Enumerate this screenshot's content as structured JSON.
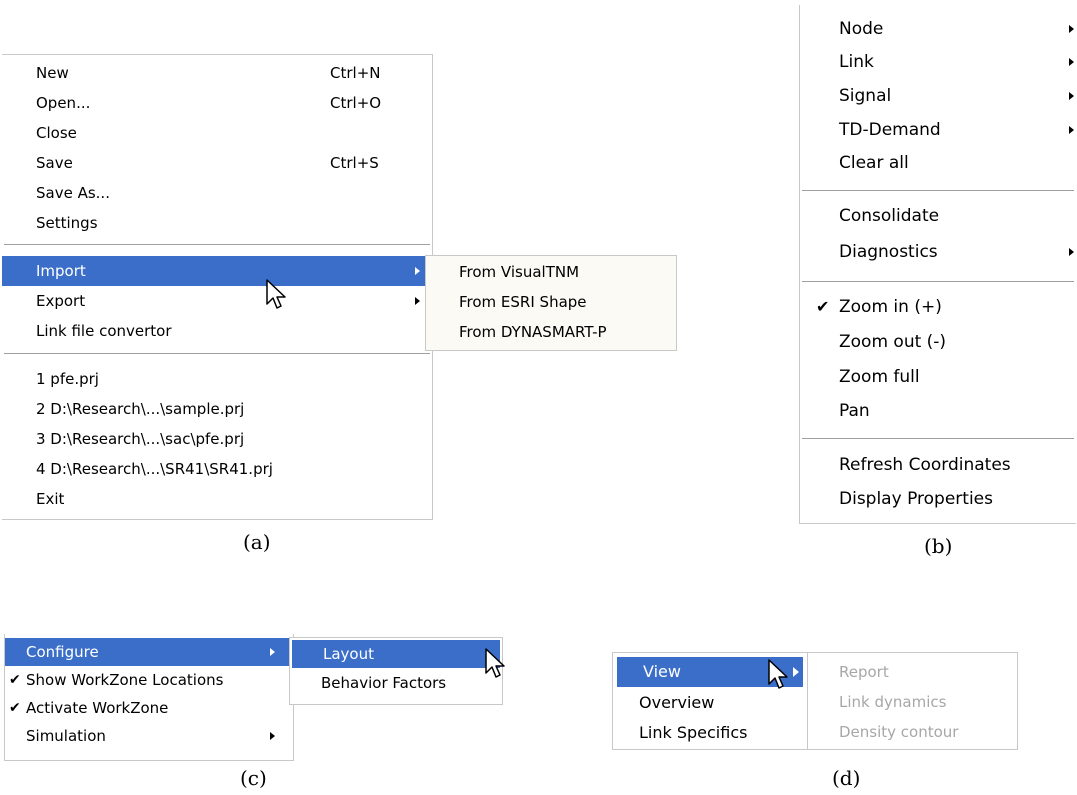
{
  "panel_a": {
    "caption": "(a)",
    "file_menu": {
      "new": {
        "label": "New",
        "shortcut": "Ctrl+N"
      },
      "open": {
        "label": "Open...",
        "shortcut": "Ctrl+O"
      },
      "close": {
        "label": "Close"
      },
      "save": {
        "label": "Save",
        "shortcut": "Ctrl+S"
      },
      "save_as": {
        "label": "Save As..."
      },
      "settings": {
        "label": "Settings"
      },
      "import": {
        "label": "Import"
      },
      "export": {
        "label": "Export"
      },
      "link_file_convertor": {
        "label": "Link file convertor"
      },
      "recent": [
        "1 pfe.prj",
        "2 D:\\Research\\...\\sample.prj",
        "3 D:\\Research\\...\\sac\\pfe.prj",
        "4 D:\\Research\\...\\SR41\\SR41.prj"
      ],
      "exit": {
        "label": "Exit"
      }
    },
    "import_submenu": [
      "From VisualTNM",
      "From ESRI Shape",
      "From DYNASMART-P"
    ]
  },
  "panel_b": {
    "caption": "(b)",
    "items": {
      "node": "Node",
      "link": "Link",
      "signal": "Signal",
      "td_demand": "TD-Demand",
      "clear_all": "Clear all",
      "consolidate": "Consolidate",
      "diagnostics": "Diagnostics",
      "zoom_in": "Zoom in (+)",
      "zoom_out": "Zoom out (-)",
      "zoom_full": "Zoom full",
      "pan": "Pan",
      "refresh_coordinates": "Refresh Coordinates",
      "display_properties": "Display Properties"
    },
    "check_mark": "✔"
  },
  "panel_c": {
    "caption": "(c)",
    "items": {
      "configure": "Configure",
      "show_workzone_locations": "Show WorkZone Locations",
      "activate_workzone": "Activate WorkZone",
      "simulation": "Simulation"
    },
    "check_mark": "✔",
    "configure_submenu": [
      "Layout",
      "Behavior Factors"
    ]
  },
  "panel_d": {
    "caption": "(d)",
    "items": {
      "view": "View",
      "overview": "Overview",
      "link_specifics": "Link Specifics"
    },
    "view_submenu_disabled": [
      "Report",
      "Link dynamics",
      "Density contour"
    ]
  },
  "colors": {
    "highlight": "#3a6ec9",
    "disabled_text": "#a7a7a7",
    "submenu_bg": "#fbfaf4"
  }
}
